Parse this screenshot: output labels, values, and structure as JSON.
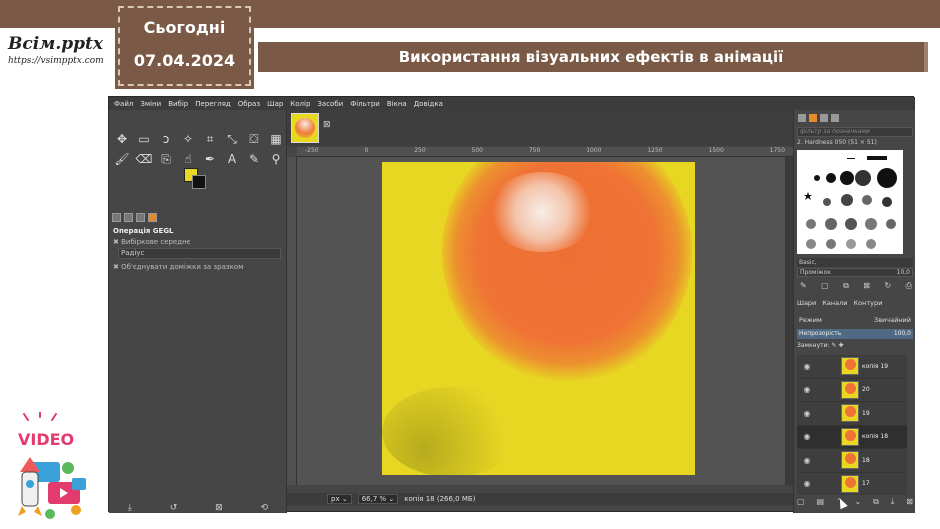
{
  "slide": {
    "brand_name": "Всім.pptx",
    "brand_url": "https://vsimpptx.com",
    "date_label": "Сьогодні",
    "date_value": "07.04.2024",
    "title": "Використання візуальних ефектів в анімації",
    "mascot_label": "VIDEO"
  },
  "menu": [
    "Файл",
    "Зміни",
    "Вибір",
    "Перегляд",
    "Образ",
    "Шар",
    "Колір",
    "Засоби",
    "Фільтри",
    "Вікна",
    "Довідка"
  ],
  "colors": {
    "foreground": "#e8d821",
    "background": "#111111",
    "accent": "#7a5a46"
  },
  "tool_icons": [
    "move-icon",
    "rect-select-icon",
    "lasso-icon",
    "fuzzy-select-icon",
    "crop-icon",
    "transform-icon",
    "bucket-fill-icon",
    "gradient-icon",
    "paintbrush-icon",
    "eraser-icon",
    "clone-icon",
    "smudge-icon",
    "path-icon",
    "text-icon",
    "color-picker-icon",
    "zoom-icon"
  ],
  "tool_options": {
    "title": "Операція GEGL",
    "option1": "Вибіркове середнє",
    "radius_label": "Радіус",
    "option2": "Об'єднувати доміжки за зразком"
  },
  "ruler": {
    "ticks": [
      "-250",
      "0",
      "250",
      "500",
      "750",
      "1000",
      "1250",
      "1500",
      "1750"
    ]
  },
  "status": {
    "unit": "px",
    "zoom": "66,7 %",
    "info": "копія 18 (266,0 МБ)"
  },
  "right_panel": {
    "filter_placeholder": "фільтр за позначками",
    "brush_name": "2. Hardness 050 (51 × 51)",
    "brush_set": "Basic,",
    "spacing_label": "Проміжок",
    "spacing_value": "10,0",
    "tabs": [
      "Шари",
      "Канали",
      "Контури"
    ],
    "mode_label": "Режим",
    "mode_value": "Звичайний",
    "opacity_label": "Непрозорість",
    "opacity_value": "100,0",
    "lock_label": "Замкнути:"
  },
  "layers": [
    {
      "name": "копія 19",
      "selected": false
    },
    {
      "name": "20",
      "selected": false
    },
    {
      "name": "19",
      "selected": false
    },
    {
      "name": "копія 18",
      "selected": true
    },
    {
      "name": "18",
      "selected": false
    },
    {
      "name": "17",
      "selected": false
    }
  ]
}
